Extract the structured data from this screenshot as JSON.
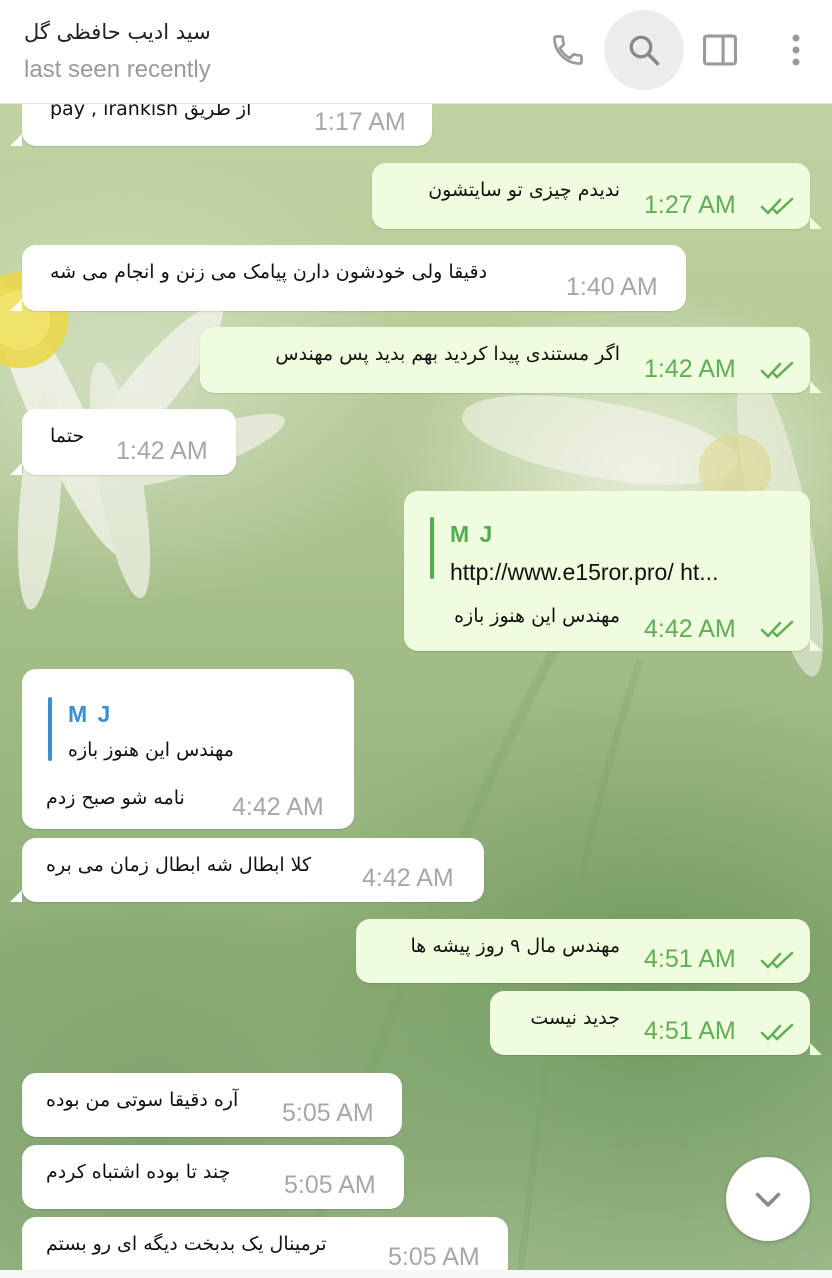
{
  "header": {
    "title": "سید ادیب حافظی گل",
    "status": "last seen recently",
    "icons": [
      "phone-icon",
      "search-icon",
      "sidebar-toggle-icon",
      "more-vertical-icon"
    ]
  },
  "colors": {
    "incoming_bubble": "#ffffff",
    "outgoing_bubble": "#effdde",
    "outgoing_time": "#5fae55",
    "incoming_time": "#a7a7a7",
    "reply_accent_out": "#4fae4e",
    "reply_accent_in": "#3a8fcf"
  },
  "messages": [
    {
      "direction": "in",
      "text": "از طریق pay , irankish",
      "time": "1:17 AM"
    },
    {
      "direction": "out",
      "text": "ندیدم چیزی تو سایتشون",
      "time": "1:27 AM",
      "read": true
    },
    {
      "direction": "in",
      "text": "دقیقا ولی خودشون دارن پیامک می زنن و انجام می شه",
      "time": "1:40 AM"
    },
    {
      "direction": "out",
      "text": "اگر مستندی پیدا کردید بهم بدید پس مهندس",
      "time": "1:42 AM",
      "read": true
    },
    {
      "direction": "in",
      "text": "حتما",
      "time": "1:42 AM"
    },
    {
      "direction": "out",
      "reply_name": "M J",
      "reply_text": "http://www.e15ror.pro/ ht...",
      "text": "مهندس این هنوز بازه",
      "time": "4:42 AM",
      "read": true
    },
    {
      "direction": "in",
      "reply_name": "M J",
      "reply_text": "مهندس این هنوز بازه",
      "text": "نامه شو صبح زدم",
      "time": "4:42 AM"
    },
    {
      "direction": "in",
      "text": "کلا ابطال شه ابطال زمان می بره",
      "time": "4:42 AM"
    },
    {
      "direction": "out",
      "text": "مهندس مال ۹ روز پیشه ها",
      "time": "4:51 AM",
      "read": true
    },
    {
      "direction": "out",
      "text": "جدید نیست",
      "time": "4:51 AM",
      "read": true
    },
    {
      "direction": "in",
      "text": "آره دقیقا سوتی من بوده",
      "time": "5:05 AM"
    },
    {
      "direction": "in",
      "text": "چند تا بوده اشتباه کردم",
      "time": "5:05 AM"
    },
    {
      "direction": "in",
      "text": "ترمینال یک بدبخت دیگه ای رو بستم",
      "time": "5:05 AM"
    }
  ],
  "scroll_button": "chevron-down-icon"
}
